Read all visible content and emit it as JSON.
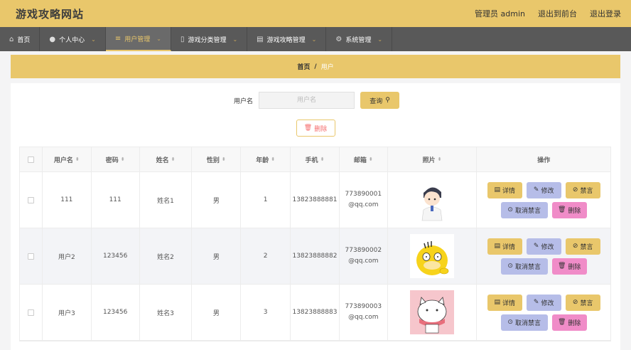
{
  "header": {
    "site_title": "游戏攻略网站",
    "admin_label": "管理员 admin",
    "front_label": "退出到前台",
    "logout_label": "退出登录"
  },
  "nav": [
    {
      "label": "首页",
      "icon": "home-icon"
    },
    {
      "label": "个人中心",
      "icon": "user-icon"
    },
    {
      "label": "用户管理",
      "icon": "sliders-icon"
    },
    {
      "label": "游戏分类管理",
      "icon": "gamepad-icon"
    },
    {
      "label": "游戏攻略管理",
      "icon": "briefcase-icon"
    },
    {
      "label": "系统管理",
      "icon": "gear-icon"
    }
  ],
  "breadcrumb": {
    "home": "首页",
    "sep": "/",
    "current": "用户"
  },
  "search": {
    "label": "用户名",
    "placeholder": "用户名",
    "button": "查询"
  },
  "delete_label": "删除",
  "table": {
    "headers": [
      "用户名",
      "密码",
      "姓名",
      "性别",
      "年龄",
      "手机",
      "邮箱",
      "照片",
      "操作"
    ],
    "rows": [
      {
        "username": "111",
        "password": "111",
        "name": "姓名1",
        "gender": "男",
        "age": "1",
        "phone": "13823888881",
        "email": "773890001@qq.com"
      },
      {
        "username": "用户2",
        "password": "123456",
        "name": "姓名2",
        "gender": "男",
        "age": "2",
        "phone": "13823888882",
        "email": "773890002@qq.com"
      },
      {
        "username": "用户3",
        "password": "123456",
        "name": "姓名3",
        "gender": "男",
        "age": "3",
        "phone": "13823888883",
        "email": "773890003@qq.com"
      }
    ],
    "actions": {
      "detail": "详情",
      "edit": "修改",
      "mute": "禁言",
      "unmute": "取消禁言",
      "delete": "删除"
    }
  },
  "colors": {
    "accent": "#e9c76b",
    "nav_bg": "#595959",
    "edit": "#b6bde8",
    "delete": "#f08cc8"
  }
}
